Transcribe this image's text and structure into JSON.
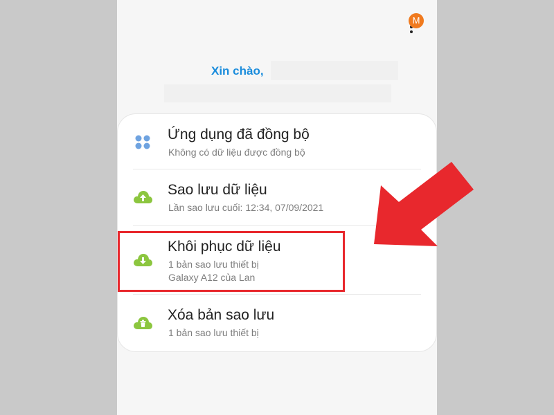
{
  "header": {
    "greeting": "Xin chào,",
    "avatar_letter": "M",
    "more_icon": "more-vertical-icon"
  },
  "menu": {
    "items": [
      {
        "title": "Ứng dụng đã đồng bộ",
        "subtitle_lines": [
          "Không có dữ liệu được đồng bộ"
        ],
        "icon": "apps-grid-icon"
      },
      {
        "title": "Sao lưu dữ liệu",
        "subtitle_lines": [
          "Lần sao lưu cuối: 12:34, 07/09/2021"
        ],
        "icon": "cloud-upload-icon"
      },
      {
        "title": "Khôi phục dữ liệu",
        "subtitle_lines": [
          "1 bản sao lưu thiết bị",
          "Galaxy A12 của Lan"
        ],
        "icon": "cloud-download-icon"
      },
      {
        "title": "Xóa bản sao lưu",
        "subtitle_lines": [
          "1 bản sao lưu thiết bị"
        ],
        "icon": "cloud-delete-icon"
      }
    ]
  },
  "colors": {
    "accent_blue": "#1a8cdc",
    "icon_green": "#8cc63f",
    "grid_blue": "#6fa3e0",
    "highlight_red": "#e8282d",
    "avatar_orange": "#f07a1e"
  }
}
